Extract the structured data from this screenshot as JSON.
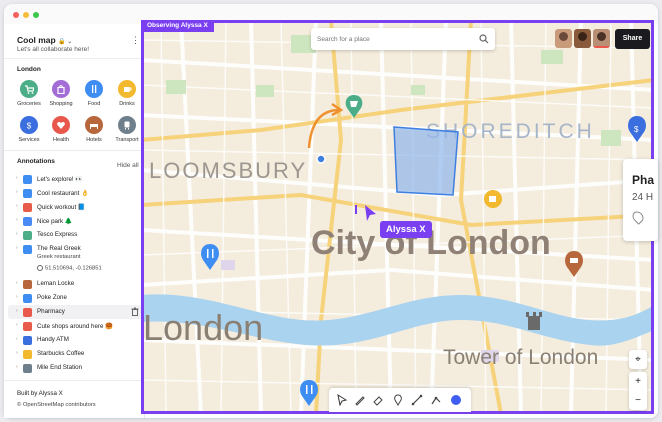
{
  "sidebar": {
    "title": "Cool map",
    "subtitle": "Let's all collaborate here!",
    "menu_icon": "⋮",
    "category_section": "London",
    "categories": [
      {
        "label": "Groceries",
        "icon": "cart-icon",
        "color": "#4cae88"
      },
      {
        "label": "Shopping",
        "icon": "bag-icon",
        "color": "#a36bd6"
      },
      {
        "label": "Food",
        "icon": "fork-knife-icon",
        "color": "#3e8df2"
      },
      {
        "label": "Drinks",
        "icon": "coffee-icon",
        "color": "#f2b92e"
      },
      {
        "label": "Services",
        "icon": "dollar-icon",
        "color": "#3b6fe0"
      },
      {
        "label": "Health",
        "icon": "heart-icon",
        "color": "#e8584c"
      },
      {
        "label": "Hotels",
        "icon": "bed-icon",
        "color": "#b8673d"
      },
      {
        "label": "Transport",
        "icon": "train-icon",
        "color": "#6f7f8c"
      }
    ],
    "annotations_header": "Annotations",
    "hide_all": "Hide all",
    "annotations": [
      {
        "text": "Let's explore! 👀",
        "icon": "text-icon",
        "color": "#3e8df2"
      },
      {
        "text": "Cool restaurant 👌",
        "icon": "pin-icon",
        "color": "#3e8df2"
      },
      {
        "text": "Quick workout 📘",
        "icon": "arrow-icon",
        "color": "#e85a4a"
      },
      {
        "text": "Nice park 🌲",
        "icon": "route-icon",
        "color": "#4a8af4"
      },
      {
        "text": "Tesco Express",
        "icon": "pin-icon",
        "color": "#4cae88"
      },
      {
        "text": "The Real Greek",
        "icon": "pin-icon",
        "color": "#3e8df2"
      },
      {
        "text": "Leman Locke",
        "icon": "pin-icon",
        "color": "#b8673d"
      },
      {
        "text": "Poke Zone",
        "icon": "pin-icon",
        "color": "#3e8df2"
      },
      {
        "text": "Pharmacy",
        "icon": "pin-icon",
        "color": "#e8584c"
      },
      {
        "text": "Cute shops around here 🥮",
        "icon": "pin-icon",
        "color": "#e85a4a"
      },
      {
        "text": "Handy ATM",
        "icon": "pin-icon",
        "color": "#3b6fe0"
      },
      {
        "text": "Starbucks Coffee",
        "icon": "pin-icon",
        "color": "#f2b92e"
      },
      {
        "text": "Mile End Station",
        "icon": "pin-icon",
        "color": "#6f7f8c"
      }
    ],
    "greek_sub": "Greek restaurant",
    "greek_coords": "51.510694, -0.126851",
    "footer_built_by": "Built by Alyssa X",
    "footer_osm": "© OpenStreetMap contributors"
  },
  "map": {
    "observing_label": "Observing Alyssa X",
    "search_placeholder": "Search for a place",
    "share_label": "Share",
    "cursor_label": "Alyssa X",
    "labels": {
      "bloomsbury": "LOOMSBURY",
      "shoreditch": "SHOREDITCH",
      "city": "City of London",
      "london": "London",
      "tower": "Tower of London"
    },
    "card_title": "Pha",
    "card_sub": "24 H",
    "zoom_in": "+",
    "zoom_out": "−",
    "accent_color": "#7b3ff2"
  }
}
